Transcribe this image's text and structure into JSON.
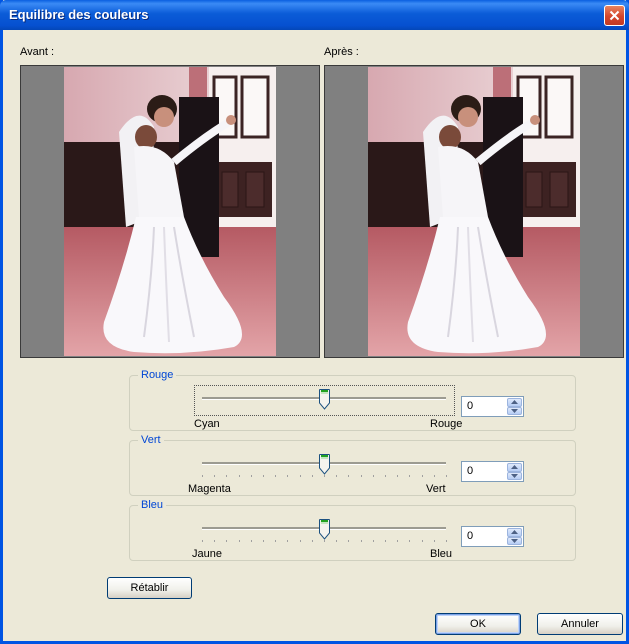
{
  "window": {
    "title": "Equilibre des couleurs"
  },
  "preview": {
    "before_label": "Avant :",
    "after_label": "Après :"
  },
  "groups": [
    {
      "title": "Rouge",
      "left_label": "Cyan",
      "right_label": "Rouge",
      "value": "0",
      "level": 0.5
    },
    {
      "title": "Vert",
      "left_label": "Magenta",
      "right_label": "Vert",
      "value": "0",
      "level": 0.5
    },
    {
      "title": "Bleu",
      "left_label": "Jaune",
      "right_label": "Bleu",
      "value": "0",
      "level": 0.5
    }
  ],
  "buttons": {
    "reset": "Rétablir",
    "ok": "OK",
    "cancel": "Annuler"
  },
  "colors": {
    "title_bar": "#0a5fe0",
    "group_title": "#0046d5",
    "dialog_bg": "#ece9d8",
    "close": "#d4452c"
  }
}
